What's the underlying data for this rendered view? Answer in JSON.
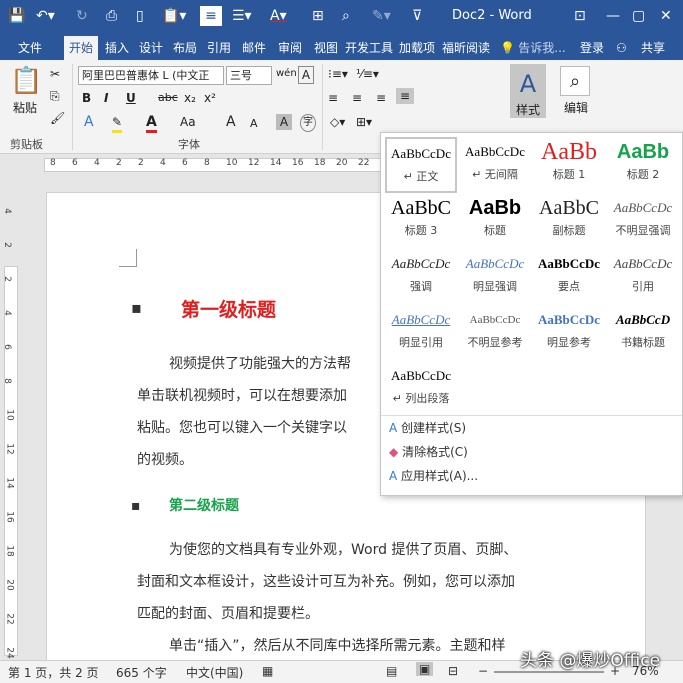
{
  "window": {
    "title": "Doc2 - Word"
  },
  "tabs": [
    "文件",
    "开始",
    "插入",
    "设计",
    "布局",
    "引用",
    "邮件",
    "审阅",
    "视图",
    "开发工具",
    "加载项",
    "福昕阅读"
  ],
  "search_hint": "告诉我...",
  "login": "登录",
  "share": "共享",
  "ribbon": {
    "paste": "粘贴",
    "font_name": "阿里巴巴普惠体 L (中文正",
    "font_size": "三号",
    "styles_btn": "样式",
    "edit_btn": "编辑",
    "group_clipboard": "剪贴板",
    "group_font": "字体",
    "bold": "B",
    "italic": "I",
    "underline": "U",
    "strike": "abc",
    "sub": "x₂",
    "sup": "x²",
    "font_color_letter": "A",
    "grow": "A",
    "shrink": "A",
    "clear_format": "Aa"
  },
  "ruler_numbers": [
    "8",
    "6",
    "4",
    "2",
    "2",
    "4",
    "6",
    "8",
    "10",
    "12",
    "14",
    "16",
    "18",
    "20",
    "22"
  ],
  "vruler_numbers": [
    "4",
    "2",
    "2",
    "4",
    "6",
    "8",
    "10",
    "12",
    "14",
    "16",
    "18",
    "20",
    "22",
    "24"
  ],
  "document": {
    "h1": "第一级标题",
    "p1": [
      "视频提供了功能强大的方法帮",
      "单击联机视频时，可以在想要添加",
      "粘贴。您也可以键入一个关键字以",
      "的视频。"
    ],
    "h2": "第二级标题",
    "p2": [
      "为使您的文档具有专业外观，Word 提供了页眉、页脚、",
      "封面和文本框设计，这些设计可互为补充。例如，您可以添加",
      "匹配的封面、页眉和提要栏。"
    ],
    "p3": "单击“插入”，然后从不同库中选择所需元素。主题和样"
  },
  "gallery": {
    "styles": [
      {
        "preview": "AaBbCcDc",
        "name": "↵ 正文",
        "color": "#000000"
      },
      {
        "preview": "AaBbCcDc",
        "name": "↵ 无间隔",
        "color": "#000000"
      },
      {
        "preview": "AaBb",
        "name": "标题 1",
        "color": "#e02020"
      },
      {
        "preview": "AaBb",
        "name": "标题 2",
        "color": "#16a34a"
      },
      {
        "preview": "AaBbC",
        "name": "标题 3",
        "color": "#000000"
      },
      {
        "preview": "AaBb",
        "name": "标题",
        "color": "#000000"
      },
      {
        "preview": "AaBbC",
        "name": "副标题",
        "color": "#222222"
      },
      {
        "preview": "AaBbCcDc",
        "name": "不明显强调",
        "color": "#555555"
      },
      {
        "preview": "AaBbCcDc",
        "name": "强调",
        "color": "#222222"
      },
      {
        "preview": "AaBbCcDc",
        "name": "明显强调",
        "color": "#4472c4"
      },
      {
        "preview": "AaBbCcDc",
        "name": "要点",
        "color": "#000000"
      },
      {
        "preview": "AaBbCcDc",
        "name": "引用",
        "color": "#444444"
      },
      {
        "preview": "AaBbCcDc",
        "name": "明显引用",
        "color": "#4472c4"
      },
      {
        "preview": "AaBbCcDc",
        "name": "不明显参考",
        "color": "#555555"
      },
      {
        "preview": "AaBbCcDc",
        "name": "明显参考",
        "color": "#4472c4"
      },
      {
        "preview": "AaBbCcD",
        "name": "书籍标题",
        "color": "#000000"
      },
      {
        "preview": "AaBbCcDc",
        "name": "↵ 列出段落",
        "color": "#000000"
      }
    ],
    "menu": [
      "创建样式(S)",
      "清除格式(C)",
      "应用样式(A)..."
    ]
  },
  "status": {
    "page": "第 1 页，共 2 页",
    "words": "665 个字",
    "lang": "中文(中国)",
    "zoom": "76%"
  },
  "watermark": "头条 @爆炒Office"
}
